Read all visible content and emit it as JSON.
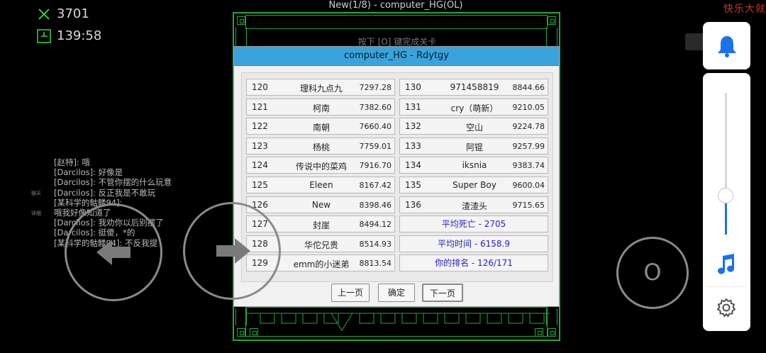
{
  "hud": {
    "deaths_value": "3701",
    "time_value": "139:58"
  },
  "window_title": "New(1/8) - computer_HG(OL)",
  "corner_text": "快乐大就",
  "hint_text": "按下 [O] 键完成关卡",
  "dialog": {
    "title": "computer_HG - Rdytgy",
    "left_rows": [
      {
        "rank": "120",
        "name": "理科九点九",
        "score": "7297.28"
      },
      {
        "rank": "121",
        "name": "柯南",
        "score": "7382.60"
      },
      {
        "rank": "122",
        "name": "南朝",
        "score": "7660.40"
      },
      {
        "rank": "123",
        "name": "杨桃",
        "score": "7759.01"
      },
      {
        "rank": "124",
        "name": "传说中的菜鸡",
        "score": "7916.70"
      },
      {
        "rank": "125",
        "name": "Eleen",
        "score": "8167.42"
      },
      {
        "rank": "126",
        "name": "New",
        "score": "8398.46"
      },
      {
        "rank": "127",
        "name": "封崖",
        "score": "8494.12"
      },
      {
        "rank": "128",
        "name": "华佗兄贵",
        "score": "8514.93"
      },
      {
        "rank": "129",
        "name": "emm的小迷弟",
        "score": "8813.54"
      }
    ],
    "right_rows": [
      {
        "rank": "130",
        "name": "971458819",
        "score": "8844.66"
      },
      {
        "rank": "131",
        "name": "cry（萌新）",
        "score": "9210.05"
      },
      {
        "rank": "132",
        "name": "空山",
        "score": "9224.78"
      },
      {
        "rank": "133",
        "name": "阿锟",
        "score": "9257.99"
      },
      {
        "rank": "134",
        "name": "iksnia",
        "score": "9383.74"
      },
      {
        "rank": "135",
        "name": "Super Boy",
        "score": "9600.04"
      },
      {
        "rank": "136",
        "name": "渣渣头",
        "score": "9715.65"
      }
    ],
    "summary": [
      "平均死亡 - 2705",
      "平均时间 - 6158.9",
      "你的排名 - 126/171"
    ],
    "prev_label": "上一页",
    "ok_label": "确定",
    "next_label": "下一页"
  },
  "chat": {
    "lines": [
      "[赵特]: 哦",
      "[Darcilos]: 好像是",
      "[Darcilos]: 不管你摆的什么玩意",
      "[Darcilos]: 反正我是不敢玩",
      "[某科学的骷髅94]:",
      "哦我好像知道了",
      "[Darcilos]: 我劝你以后别摆了",
      "[Darcilos]: 挺傻，*的",
      "[某科学的骷髅94]: 不反我提"
    ],
    "side_label_chat": "聊天",
    "side_label_detail": "详细"
  },
  "controls": {
    "action_label": "O"
  },
  "colors": {
    "frame_green": "#1fa83a",
    "dialog_title_blue": "#3ba3db",
    "summary_text": "#2222cc",
    "accent_blue": "#1a73e8"
  },
  "volume_level_percent": 27
}
